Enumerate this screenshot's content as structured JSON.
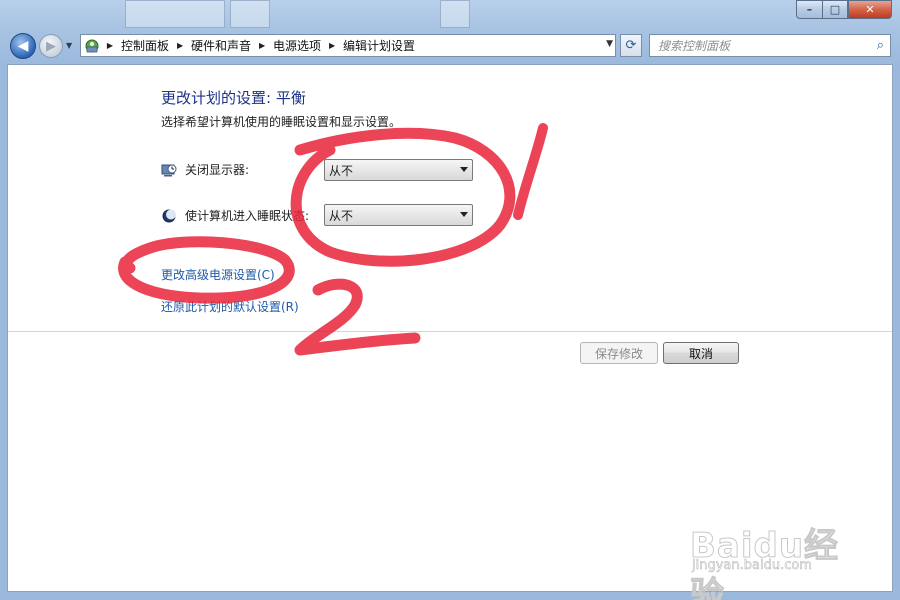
{
  "window": {
    "caption_min": "–",
    "caption_max": "□",
    "caption_close": "✕"
  },
  "nav": {
    "back_glyph": "◀",
    "forward_glyph": "▶",
    "recent_glyph": "▼",
    "refresh_glyph": "⟳",
    "address_icon": "control-panel-icon",
    "breadcrumbs": [
      "控制面板",
      "硬件和声音",
      "电源选项",
      "编辑计划设置"
    ],
    "search_placeholder": "搜索控制面板",
    "search_glyph": "⌕"
  },
  "page": {
    "title": "更改计划的设置: 平衡",
    "subtitle": "选择希望计算机使用的睡眠设置和显示设置。",
    "settings": [
      {
        "label": "关闭显示器:",
        "icon": "display-power-icon",
        "value": "从不"
      },
      {
        "label": "使计算机进入睡眠状态:",
        "icon": "sleep-moon-icon",
        "value": "从不"
      }
    ],
    "links": {
      "advanced": "更改高级电源设置(C)",
      "restore": "还原此计划的默认设置(R)"
    },
    "buttons": {
      "save": "保存修改",
      "cancel": "取消"
    }
  },
  "annotations": {
    "color": "#e8243a",
    "labels": [
      "1",
      "2"
    ]
  },
  "watermark": {
    "brand": "Baidu经验",
    "url": "jingyan.baidu.com"
  }
}
